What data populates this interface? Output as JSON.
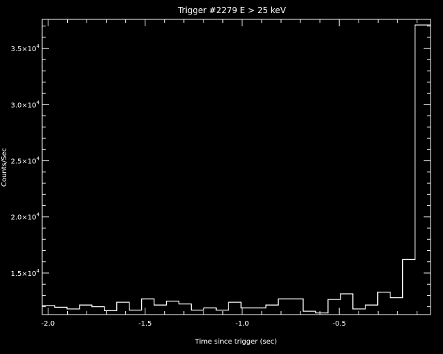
{
  "chart_data": {
    "type": "line",
    "style": "histogram-step",
    "title": "Trigger #2279 E > 25 keV",
    "xlabel": "Time since trigger (sec)",
    "ylabel": "Counts/Sec",
    "xlim": [
      -2.03,
      -0.03
    ],
    "ylim": [
      11300,
      37600
    ],
    "x_ticks": [
      -2.0,
      -1.5,
      -1.0,
      -0.5
    ],
    "x_tick_labels": [
      "-2.0",
      "-1.5",
      "-1.0",
      "-0.5"
    ],
    "y_ticks": [
      15000,
      20000,
      25000,
      30000,
      35000
    ],
    "y_tick_labels": [
      {
        "mant": "1.5×10",
        "exp": "4"
      },
      {
        "mant": "2.0×10",
        "exp": "4"
      },
      {
        "mant": "2.5×10",
        "exp": "4"
      },
      {
        "mant": "3.0×10",
        "exp": "4"
      },
      {
        "mant": "3.5×10",
        "exp": "4"
      }
    ],
    "bin_edges": [
      -2.03,
      -1.966,
      -1.902,
      -1.838,
      -1.774,
      -1.71,
      -1.646,
      -1.582,
      -1.518,
      -1.454,
      -1.39,
      -1.326,
      -1.262,
      -1.198,
      -1.134,
      -1.07,
      -1.006,
      -0.942,
      -0.878,
      -0.814,
      -0.75,
      -0.686,
      -0.622,
      -0.558,
      -0.494,
      -0.43,
      -0.366,
      -0.302,
      -0.238,
      -0.174,
      -0.11,
      -0.046,
      -0.03
    ],
    "counts": [
      12100,
      11950,
      11800,
      12150,
      12000,
      11650,
      12400,
      11700,
      12700,
      12150,
      12500,
      12250,
      11700,
      11900,
      11700,
      12400,
      11900,
      11900,
      12150,
      12700,
      12700,
      11600,
      11450,
      12650,
      13150,
      11800,
      12150,
      13300,
      12800,
      16200,
      37100,
      37100
    ],
    "grid": false,
    "legend": "none"
  }
}
